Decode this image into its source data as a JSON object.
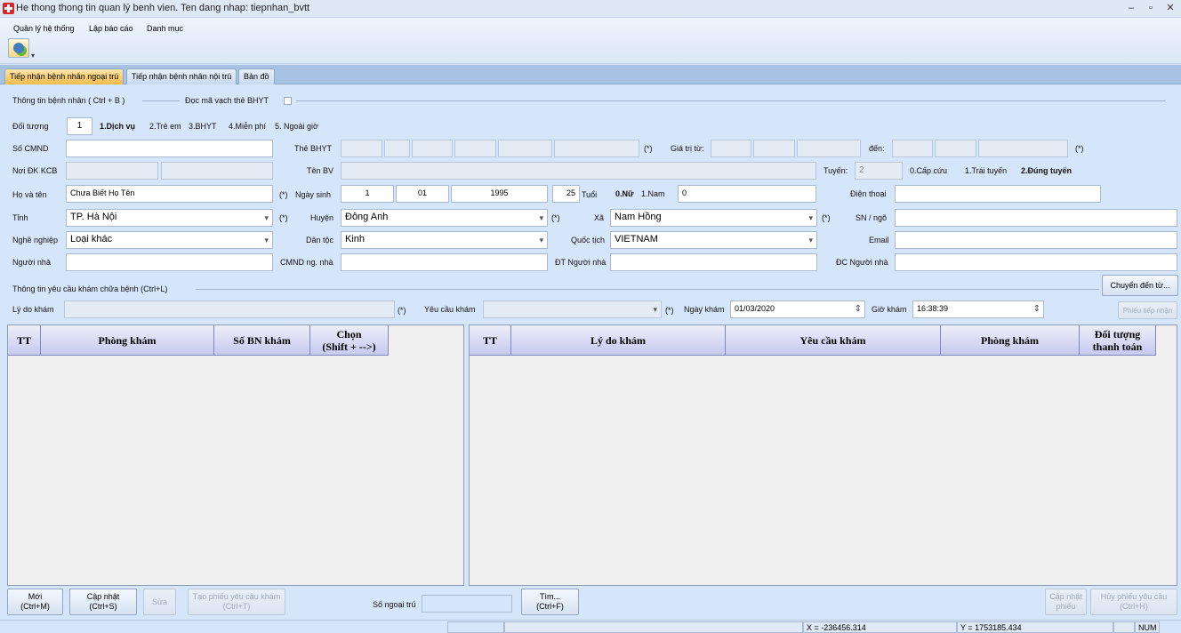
{
  "window": {
    "title": "He thong thong tin quan lý benh vien. Ten dang nhap: tiepnhan_bvtt"
  },
  "menu": [
    "Quản lý hệ thống",
    "Lập báo cáo",
    "Danh mục"
  ],
  "tabs": [
    "Tiếp nhận bệnh nhân ngoại trú",
    "Tiếp nhận bệnh nhân nội trú",
    "Bản đồ"
  ],
  "section1": {
    "title": "Thông tin bệnh nhân ( Ctrl + B )",
    "barcode_label": "Đọc mã vạch thẻ BHYT"
  },
  "labels": {
    "doi_tuong": "Đối tượng",
    "so_cmnd": "Số CMND",
    "the_bhyt": "Thẻ BHYT",
    "gia_tri_tu": "Giá trị từ:",
    "den": "đến:",
    "noi_dk_kcb": "Nơi ĐK KCB",
    "ten_bv": "Tên BV",
    "tuyen": "Tuyến:",
    "ho_va_ten": "Họ và tên",
    "ngay_sinh": "Ngày sinh",
    "tuoi": "Tuổi",
    "dien_thoai": "Điện thoại",
    "tinh": "Tỉnh",
    "huyen": "Huyện",
    "xa": "Xã",
    "sn_ngo": "SN / ngõ",
    "nghe_nghiep": "Nghề nghiệp",
    "dan_toc": "Dân tộc",
    "quoc_tich": "Quốc tịch",
    "email": "Email",
    "nguoi_nha": "Người nhà",
    "cmnd_ng_nha": "CMND ng. nhà",
    "dt_nguoi_nha": "ĐT Người nhà",
    "dc_nguoi_nha": "ĐC Người nhà",
    "required": "(*)"
  },
  "doi_tuong": {
    "value": "1",
    "opt1": "1.Dịch vụ",
    "opt2": "2.Trẻ em",
    "opt3": "3.BHYT",
    "opt4": "4.Miễn phí",
    "opt5": "5. Ngoài giờ"
  },
  "tuyen": {
    "value": "2",
    "opt0": "0.Cấp cứu",
    "opt1": "1.Trái tuyến",
    "opt2": "2.Đúng tuyến"
  },
  "patient": {
    "ho_ten": "Chưa Biết Họ Tên",
    "ngay": "1",
    "thang": "01",
    "nam": "1995",
    "tuoi": "25",
    "gioi_nu": "0.Nữ",
    "gioi_nam": "1.Nam",
    "gioi_value": "0",
    "tinh": "TP. Hà Nội",
    "huyen": "Đông Anh",
    "xa": "Nam Hồng",
    "nghe_nghiep": "Loại khác",
    "dan_toc": "Kinh",
    "quoc_tich": "VIETNAM"
  },
  "section2": {
    "title": "Thông tin yêu cầu khám chữa bệnh (Ctrl+L)",
    "chuyen_den": "Chuyển đến từ...",
    "ly_do_kham": "Lý do khám",
    "yeu_cau_kham": "Yêu cầu khám",
    "ngay_kham_label": "Ngày khám",
    "ngay_kham": "01/03/2020",
    "gio_kham_label": "Giờ khám",
    "gio_kham": "16:38:39",
    "phieu_tiep_nhan": "Phiếu tiếp nhận"
  },
  "left_grid": {
    "headers": [
      "TT",
      "Phòng khám",
      "Số BN khám",
      "Chọn\n(Shift + -->)"
    ]
  },
  "right_grid": {
    "headers": [
      "TT",
      "Lý do khám",
      "Yêu cầu khám",
      "Phòng khám",
      "Đối tượng\nthanh toán"
    ]
  },
  "buttons": {
    "moi": [
      "Mới",
      "(Ctrl+M)"
    ],
    "cap_nhat": [
      "Cập nhật",
      "(Ctrl+S)"
    ],
    "sua": "Sửa",
    "tao_phieu": [
      "Tạo phiếu yêu cầu khám",
      "(Ctrl+T)"
    ],
    "so_ngoai_tru": "Số ngoại trú",
    "tim": [
      "Tìm...",
      "(Ctrl+F)"
    ],
    "cap_nhat_phieu": [
      "Cập nhật",
      "phiếu"
    ],
    "huy_phieu": [
      "Hủy phiếu yêu cầu",
      "(Ctrl+H)"
    ]
  },
  "status": {
    "x": "X = -236456.314",
    "y": "Y = 1753185.434",
    "num": "NUM"
  }
}
